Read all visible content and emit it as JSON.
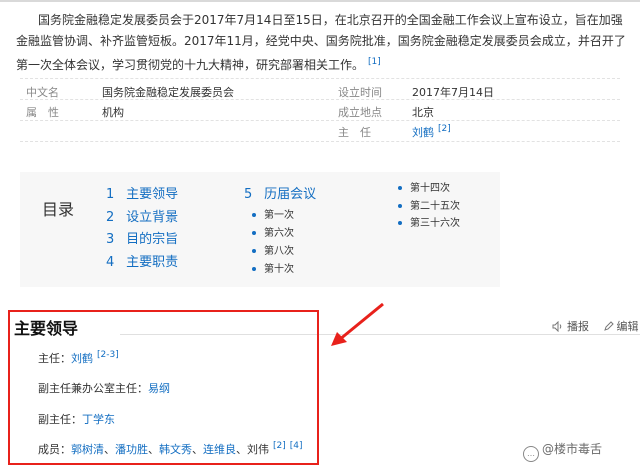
{
  "intro": {
    "text": "国务院金融稳定发展委员会于2017年7月14日至15日，在北京召开的全国金融工作会议上宣布设立，旨在加强金融监管协调、补齐监管短板。2017年11月，经党中央、国务院批准，国务院金融稳定发展委员会成立，并召开了第一次全体会议，学习贯彻党的十九大精神，研究部署相关工作。",
    "ref": "[1]"
  },
  "infobox": {
    "rows": [
      {
        "k1": "中文名",
        "v1": "国务院金融稳定发展委员会",
        "k2": "设立时间",
        "v2": "2017年7月14日"
      },
      {
        "k1": "属　性",
        "v1": "机构",
        "k2": "成立地点",
        "v2": "北京"
      },
      {
        "k1": "",
        "v1": "",
        "k2": "主　任",
        "v2": "刘鹤",
        "v2_ref": "[2]"
      }
    ]
  },
  "toc": {
    "title": "目录",
    "items": [
      {
        "num": "1",
        "label": "主要领导"
      },
      {
        "num": "2",
        "label": "设立背景"
      },
      {
        "num": "3",
        "label": "目的宗旨"
      },
      {
        "num": "4",
        "label": "主要职责"
      },
      {
        "num": "5",
        "label": "历届会议"
      }
    ],
    "subs_col1": [
      "第一次",
      "第六次",
      "第八次",
      "第十次"
    ],
    "subs_col2": [
      "第十四次",
      "第二十五次",
      "第三十六次"
    ]
  },
  "section": {
    "title": "主要领导",
    "tools": {
      "edit_label": "播报",
      "edit2_label": "编辑"
    }
  },
  "leaders": {
    "chair_label": "主任：",
    "chair_name": "刘鹤",
    "chair_ref": "[2-3]",
    "vice_office_label": "副主任兼办公室主任：",
    "vice_office_name": "易纲",
    "vice_label": "副主任：",
    "vice_name": "丁学东",
    "members_label": "成员：",
    "members": [
      "郭树清",
      "潘功胜",
      "韩文秀",
      "连维良"
    ],
    "members_plain": "刘伟",
    "members_ref1": "[2]",
    "members_ref2": "[4]"
  },
  "watermark": {
    "text": "@楼市毒舌",
    "icon": "chat-bubble-icon"
  },
  "colors": {
    "link": "#136ec2",
    "highlight_box": "#e8211b",
    "toc_bg": "#f7f7f7"
  }
}
